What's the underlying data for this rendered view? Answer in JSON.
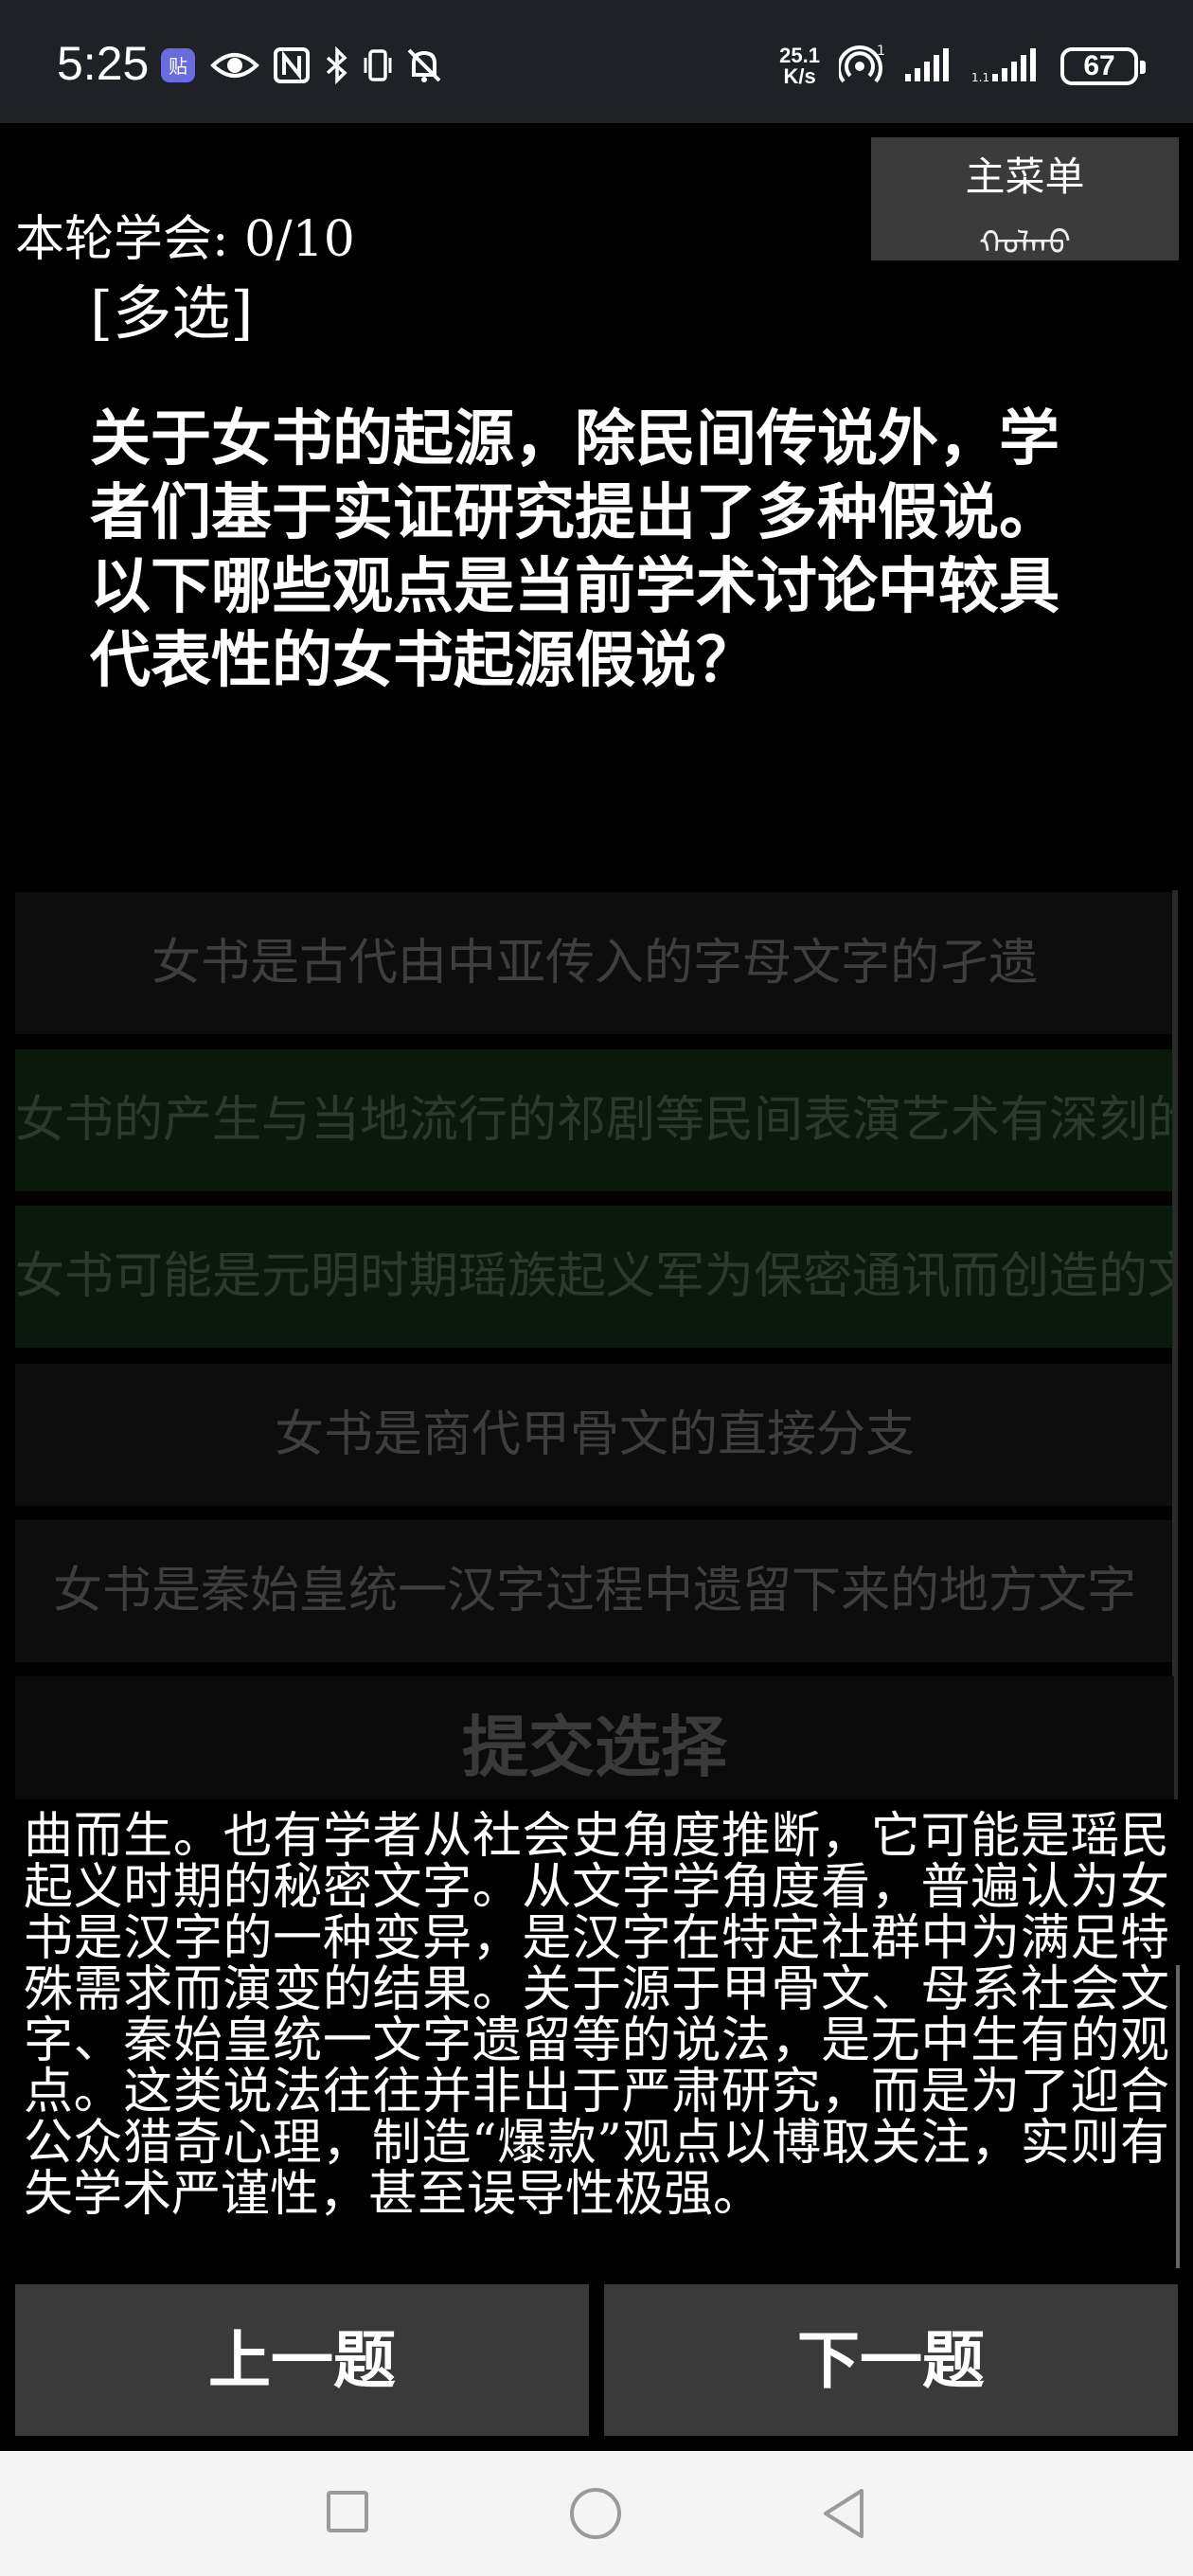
{
  "status_bar": {
    "time": "5:25",
    "speed_value": "25.1",
    "speed_unit": "K/s",
    "battery": "67",
    "icons": [
      "app-badge-icon",
      "eye-icon",
      "nfc-icon",
      "bluetooth-icon",
      "vibrate-icon",
      "mute-icon",
      "hotspot-icon",
      "signal-icon",
      "signal-icon-2",
      "battery-icon"
    ]
  },
  "header": {
    "menu_label": "主菜单",
    "menu_sub": "ᠬᠣᠯᠬᠣ",
    "progress": "本轮学会: 0/10"
  },
  "question": {
    "type": "[多选]",
    "text": "关于女书的起源，除民间传说外，学者们基于实证研究提出了多种假说。以下哪些观点是当前学术讨论中较具代表性的女书起源假说？"
  },
  "options": [
    {
      "text": "女书是古代由中亚传入的字母文字的孑遗",
      "selected": false
    },
    {
      "text": "女书的产生与当地流行的祁剧等民间表演艺术有深刻的互文关系",
      "selected": true
    },
    {
      "text": "女书可能是元明时期瑶族起义军为保密通讯而创造的文字",
      "selected": true
    },
    {
      "text": "女书是商代甲骨文的直接分支",
      "selected": false
    },
    {
      "text": "女书是秦始皇统一汉字过程中遗留下来的地方文字",
      "selected": false
    }
  ],
  "submit_label": "提交选择",
  "explanation": "该观点是一般说，认为女书是为祁剧和戏剧等地方戏曲而生。也有学者从社会史角度推断，它可能是瑶民起义时期的秘密文字。从文字学角度看，普遍认为女书是汉字的一种变异，是汉字在特定社群中为满足特殊需求而演变的结果。关于源于甲骨文、母系社会文字、秦始皇统一文字遗留等的说法，是无中生有的观点。这类说法往往并非出于严肃研究，而是为了迎合公众猎奇心理，制造“爆款”观点以博取关注，实则有失学术严谨性，甚至误导性极强。",
  "nav": {
    "prev_label": "上一题",
    "next_label": "下一题"
  }
}
